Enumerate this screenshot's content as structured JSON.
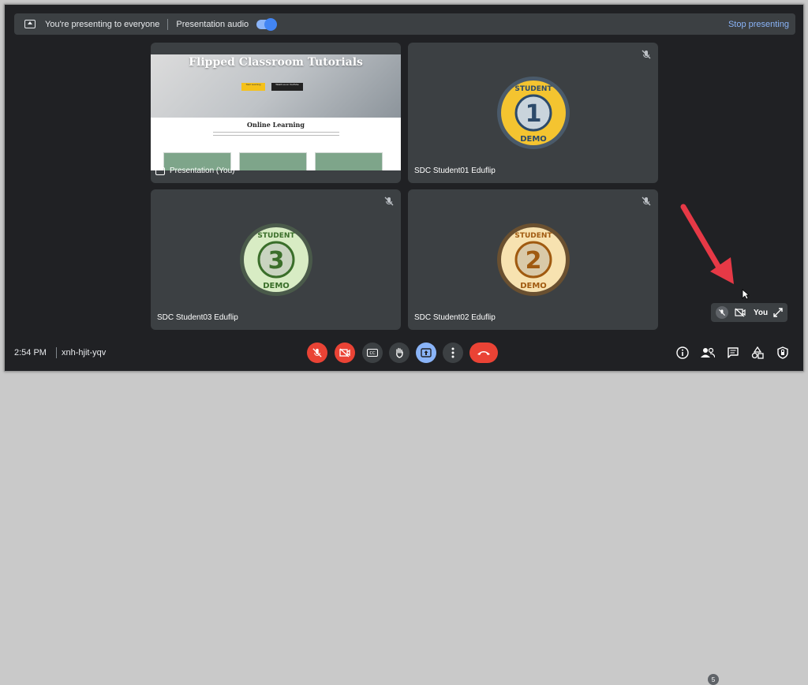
{
  "banner": {
    "presenting_text": "You're presenting to everyone",
    "audio_label": "Presentation audio",
    "audio_on": true,
    "stop_label": "Stop presenting"
  },
  "tiles": [
    {
      "name": "Presentation (You)",
      "type": "presentation"
    },
    {
      "name": "SDC Student01 Eduflip",
      "badge_number": "1",
      "badge_top": "STUDENT",
      "badge_bottom": "DEMO",
      "muted": true
    },
    {
      "name": "SDC Student03 Eduflip",
      "badge_number": "3",
      "badge_top": "STUDENT",
      "badge_bottom": "DEMO",
      "muted": true
    },
    {
      "name": "SDC Student02 Eduflip",
      "badge_number": "2",
      "badge_top": "STUDENT",
      "badge_bottom": "DEMO",
      "muted": true
    }
  ],
  "slide": {
    "title": "Flipped Classroom Tutorials",
    "btn1": "Start Learning",
    "btn2": "Watch us on YouTube",
    "subtitle": "Online Learning"
  },
  "self_view": {
    "label": "You"
  },
  "bottom": {
    "time": "2:54 PM",
    "meeting_code": "xnh-hjit-yqv",
    "participants_count": "5"
  },
  "colors": {
    "badge1_fill": "#f4c430",
    "badge2_fill": "#f7e2b0",
    "badge3_fill": "#d8ecc4",
    "danger": "#ea4335",
    "accent": "#8ab4f8"
  }
}
